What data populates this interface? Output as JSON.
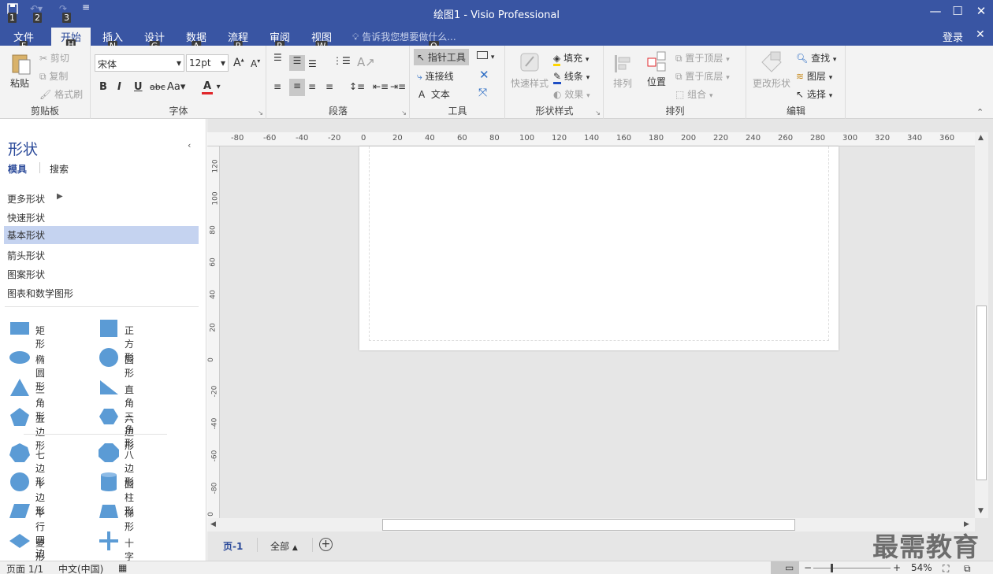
{
  "window": {
    "title": "绘图1 - Visio Professional",
    "minimize_icon": "minimize-icon",
    "maximize_icon": "maximize-icon",
    "close_icon": "close-icon"
  },
  "qat": {
    "save_keytip": "1",
    "undo_keytip": "2",
    "redo_keytip": "3"
  },
  "tabs": [
    {
      "label": "文件",
      "keytip": "F"
    },
    {
      "label": "开始",
      "keytip": "H"
    },
    {
      "label": "插入",
      "keytip": "N"
    },
    {
      "label": "设计",
      "keytip": "G"
    },
    {
      "label": "数据",
      "keytip": "A"
    },
    {
      "label": "流程",
      "keytip": "P"
    },
    {
      "label": "审阅",
      "keytip": "R"
    },
    {
      "label": "视图",
      "keytip": "W"
    }
  ],
  "tell_me": "告诉我您想要做什么...",
  "tell_me_keytip": "Q",
  "login": "登录",
  "ribbon": {
    "clipboard": {
      "label": "剪贴板",
      "paste": "粘贴",
      "cut": "剪切",
      "copy": "复制",
      "format_painter": "格式刷"
    },
    "font": {
      "label": "字体",
      "font_name": "宋体",
      "font_size": "12pt",
      "bold": "B",
      "italic": "I",
      "underline": "U",
      "strike": "abc",
      "case": "Aa",
      "color": "A"
    },
    "paragraph": {
      "label": "段落"
    },
    "tools": {
      "label": "工具",
      "pointer": "指针工具",
      "connector": "连接线",
      "text": "文本"
    },
    "shape_styles": {
      "label": "形状样式",
      "quick_styles": "快速样式",
      "fill": "填充",
      "line": "线条",
      "effects": "效果"
    },
    "arrange": {
      "label": "排列",
      "align": "排列",
      "position": "位置",
      "bring_front": "置于顶层",
      "send_back": "置于底层",
      "group": "组合"
    },
    "edit": {
      "label": "编辑",
      "change_shape": "更改形状",
      "find": "查找",
      "layers": "图层",
      "select": "选择"
    }
  },
  "shapes_pane": {
    "title": "形状",
    "tab_stencils": "模具",
    "tab_search": "搜索",
    "categories": [
      "更多形状",
      "快速形状",
      "基本形状",
      "箭头形状",
      "图案形状",
      "图表和数学图形"
    ],
    "shapes": [
      "矩形",
      "正方形",
      "椭圆形",
      "圆形",
      "三角形",
      "直角三角形",
      "五边形",
      "六边形",
      "七边形",
      "八边形",
      "十边形",
      "圆柱形",
      "平行四边形",
      "梯形",
      "菱形",
      "十字形"
    ]
  },
  "rulers": {
    "h": [
      "-80",
      "-60",
      "-40",
      "-20",
      "0",
      "20",
      "40",
      "60",
      "80",
      "100",
      "120",
      "140",
      "160",
      "180",
      "200",
      "220",
      "240",
      "260",
      "280",
      "300",
      "320",
      "340",
      "360"
    ],
    "v": [
      "120",
      "100",
      "80",
      "60",
      "40",
      "20",
      "0",
      "-20",
      "-40",
      "-60",
      "-80",
      "0"
    ]
  },
  "page_tabs": {
    "page": "页-1",
    "all": "全部"
  },
  "status": {
    "page": "页面 1/1",
    "language": "中文(中国)",
    "zoom": "54%"
  },
  "watermark": "最需教育",
  "colors": {
    "accent": "#3955a3",
    "shape_blue": "#5b9bd5",
    "selected": "#c5d3f0"
  }
}
